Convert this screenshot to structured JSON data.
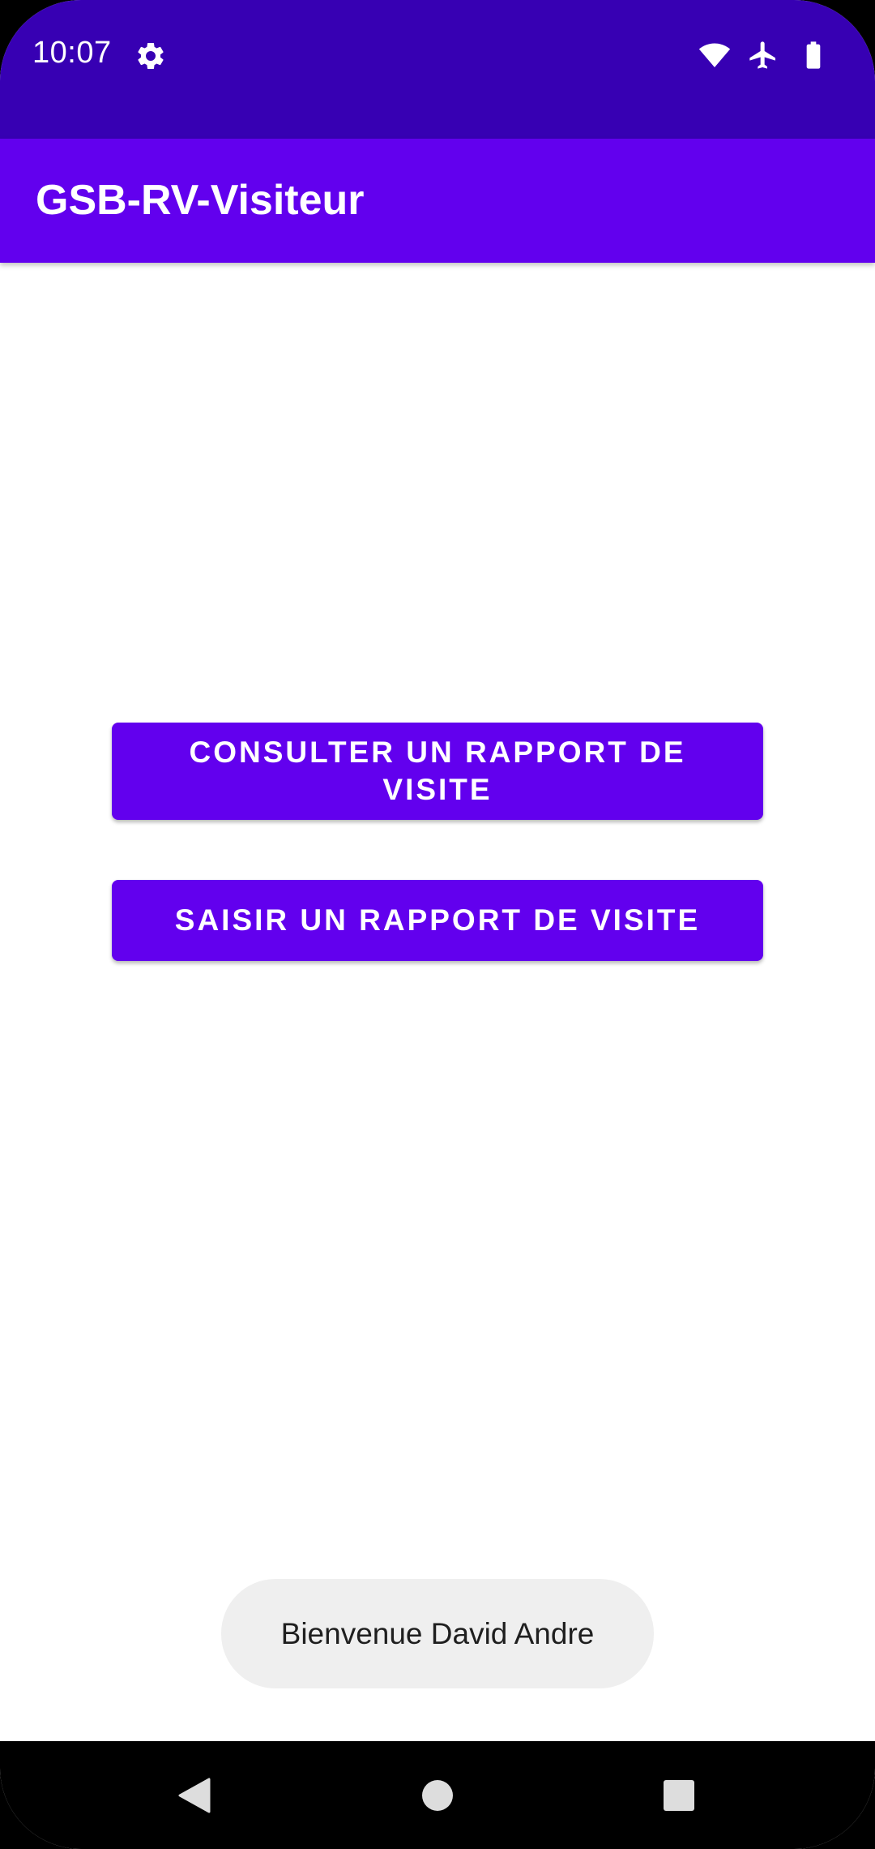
{
  "status_bar": {
    "time": "10:07",
    "icons": [
      "gear-icon",
      "wifi-icon",
      "airplane-icon",
      "battery-icon"
    ]
  },
  "app_bar": {
    "title": "GSB-RV-Visiteur"
  },
  "main": {
    "buttons": [
      {
        "label": "CONSULTER UN RAPPORT DE VISITE"
      },
      {
        "label": "SAISIR UN RAPPORT DE VISITE"
      }
    ]
  },
  "toast": {
    "message": "Bienvenue David Andre"
  },
  "nav_bar": {
    "icons": [
      "back-icon",
      "home-icon",
      "recents-icon"
    ]
  },
  "colors": {
    "status_bar": "#3700B3",
    "primary": "#6200EE",
    "toast_bg": "#EFEFEF",
    "background": "#FFFFFF"
  }
}
